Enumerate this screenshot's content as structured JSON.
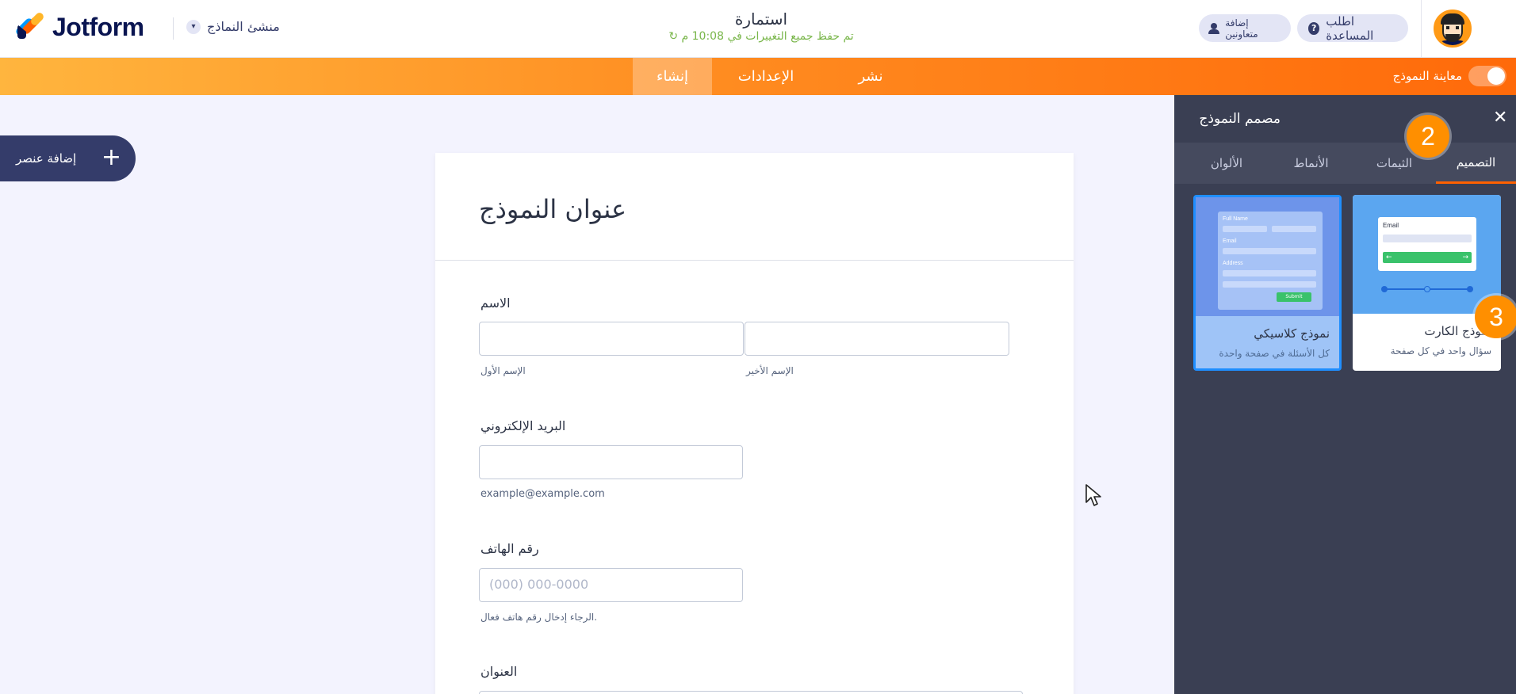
{
  "header": {
    "logo_text": "Jotform",
    "builder_menu": "منشئ النماذج",
    "form_title": "استمارة",
    "save_status": "تم حفظ جميع التغييرات في 10:08 م",
    "help_button": "اطلب المساعدة",
    "collaborators_button": "إضافة متعاونين"
  },
  "nav": {
    "publish": "نشر",
    "settings": "الإعدادات",
    "build": "إنشاء",
    "preview_label": "معاينة النموذج"
  },
  "add_element": "إضافة عنصر",
  "form": {
    "heading": "عنوان النموذج",
    "name_label": "الاسم",
    "first_name_sublabel": "الإسم الأول",
    "last_name_sublabel": "الإسم الأخير",
    "email_label": "البريد الإلكتروني",
    "email_sublabel": "example@example.com",
    "phone_label": "رقم الهاتف",
    "phone_placeholder": "(000) 000-0000",
    "phone_sublabel": "الرجاء إدخال رقم هاتف فعال.",
    "address_label": "العنوان"
  },
  "panel": {
    "title": "مصمم النموذج",
    "tabs": [
      "التصميم",
      "الثيمات",
      "الأنماط",
      "الألوان"
    ],
    "active_tab": "التصميم",
    "badges": [
      "2",
      "3"
    ],
    "cards": [
      {
        "name": "نموذج الكارت",
        "description": "سؤال واحد في كل صفحة",
        "preview_label": "Email",
        "selected": false
      },
      {
        "name": "نموذج كلاسيكي",
        "description": "كل الأسئلة في صفحة واحدة",
        "preview_labels": [
          "Full Name",
          "Email",
          "Address"
        ],
        "preview_button": "Submit",
        "selected": true
      }
    ]
  },
  "colors": {
    "brand_orange": "#ff6100",
    "nav_gradient_start": "#ffb53e",
    "nav_gradient_end": "#ff6a0a",
    "panel_bg": "#3a3f53",
    "dark_navy": "#343c6a",
    "save_green": "#79b64a",
    "badge_orange": "#ff8f00"
  }
}
